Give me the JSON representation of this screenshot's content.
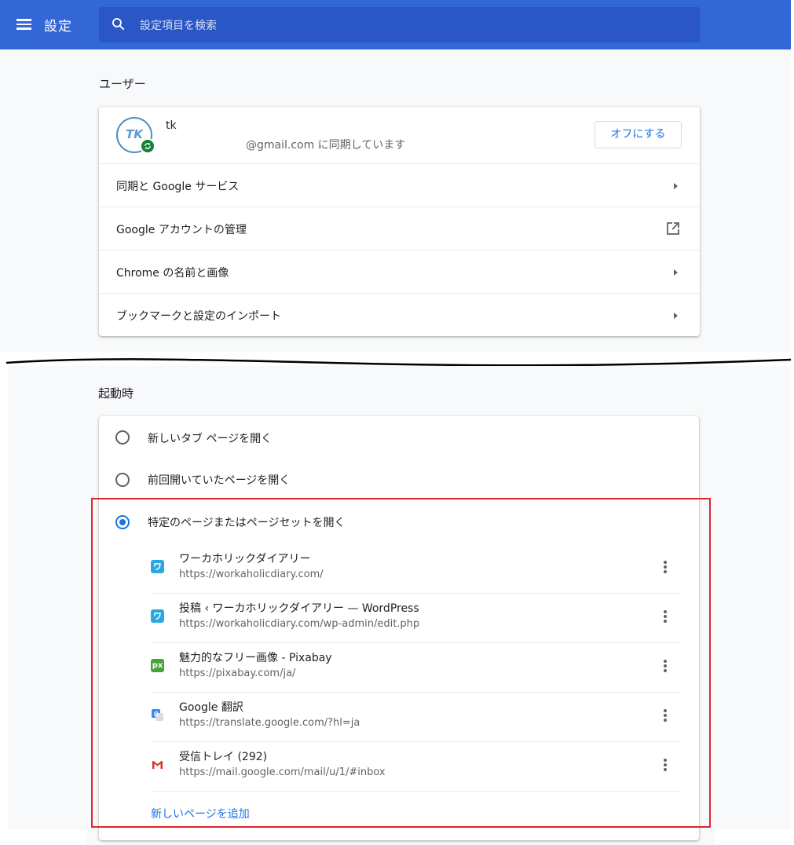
{
  "header": {
    "title": "設定",
    "search_placeholder": "設定項目を検索"
  },
  "user_section": {
    "title": "ユーザー",
    "avatar_initials": "TK",
    "name": "tk",
    "sync_status": "@gmail.com に同期しています",
    "off_button": "オフにする",
    "rows": [
      {
        "label": "同期と Google サービス",
        "icon": "chevron-right-icon"
      },
      {
        "label": "Google アカウントの管理",
        "icon": "open-in-new-icon"
      },
      {
        "label": "Chrome の名前と画像",
        "icon": "chevron-right-icon"
      },
      {
        "label": "ブックマークと設定のインポート",
        "icon": "chevron-right-icon"
      }
    ]
  },
  "startup_section": {
    "title": "起動時",
    "options": [
      {
        "label": "新しいタブ ページを開く",
        "checked": false
      },
      {
        "label": "前回開いていたページを開く",
        "checked": false
      },
      {
        "label": "特定のページまたはページセットを開く",
        "checked": true
      }
    ],
    "pages": [
      {
        "title": "ワーカホリックダイアリー",
        "url": "https://workaholicdiary.com/",
        "favicon": "workaholicdiary-icon",
        "favicon_text": "ワ"
      },
      {
        "title": "投稿 ‹ ワーカホリックダイアリー — WordPress",
        "url": "https://workaholicdiary.com/wp-admin/edit.php",
        "favicon": "workaholicdiary-icon",
        "favicon_text": "ワ"
      },
      {
        "title": "魅力的なフリー画像 - Pixabay",
        "url": "https://pixabay.com/ja/",
        "favicon": "pixabay-icon",
        "favicon_text": "px"
      },
      {
        "title": "Google 翻訳",
        "url": "https://translate.google.com/?hl=ja",
        "favicon": "google-translate-icon",
        "favicon_text": ""
      },
      {
        "title": "受信トレイ (292)",
        "url": "https://mail.google.com/mail/u/1/#inbox",
        "favicon": "gmail-icon",
        "favicon_text": ""
      }
    ],
    "add_page": "新しいページを追加"
  },
  "colors": {
    "topbar": "#3367d6",
    "accent": "#1a73e8",
    "highlight_border": "#e0242b"
  }
}
